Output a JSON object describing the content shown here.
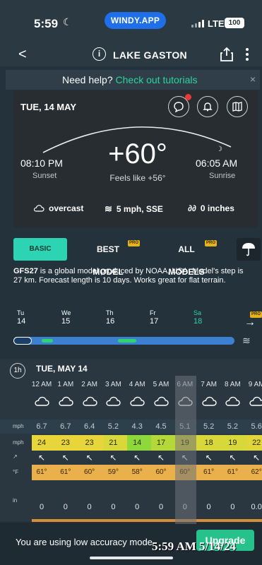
{
  "status_bar": {
    "time": "5:59",
    "app_pill": "WINDY.APP",
    "network": "LTE",
    "battery": "100"
  },
  "header": {
    "title": "LAKE GASTON",
    "info": "i"
  },
  "help_banner": {
    "text": "Need help?",
    "link": "Check out tutorials",
    "close": "×"
  },
  "summary": {
    "date": "TUE, 14 MAY",
    "temperature": "+60°",
    "feels_like": "Feels like +56°",
    "sunset_time": "08:10 PM",
    "sunset_label": "Sunset",
    "sunrise_time": "06:05 AM",
    "sunrise_label": "Sunrise",
    "cloud": "overcast",
    "wind": "5 mph, SSE",
    "precip": "0 inches"
  },
  "model_tabs": {
    "basic": "BASIC",
    "best": "BEST MODEL",
    "all": "ALL MODELS",
    "pro_badge": "PRO"
  },
  "description": {
    "model": "GFS27",
    "text": " is a global model produced by NOAA, USA. Model's step is 27 km. Forecast length is 10 days. Works great for flat terrain."
  },
  "days": [
    {
      "dow": "Tu",
      "num": "14"
    },
    {
      "dow": "We",
      "num": "15"
    },
    {
      "dow": "Th",
      "num": "16"
    },
    {
      "dow": "Fr",
      "num": "17"
    },
    {
      "dow": "Sa",
      "num": "18"
    }
  ],
  "table": {
    "interval": "1h",
    "date": "TUE, MAY 14",
    "hours": [
      "12 AM",
      "1 AM",
      "2 AM",
      "3 AM",
      "4 AM",
      "5 AM",
      "6 AM",
      "7 AM",
      "8 AM",
      "9 AM"
    ],
    "labels": {
      "wind": "mph",
      "gust": "mph",
      "temp": "°F",
      "precip": "in"
    },
    "wind": [
      "6.7",
      "6.7",
      "6.4",
      "5.2",
      "4.3",
      "4.5",
      "5.1",
      "5.2",
      "5.2",
      "5.6"
    ],
    "gust": [
      "24",
      "23",
      "23",
      "21",
      "14",
      "17",
      "19",
      "18",
      "19",
      "22"
    ],
    "temp": [
      "61°",
      "61°",
      "60°",
      "59°",
      "58°",
      "60°",
      "60°",
      "61°",
      "61°",
      "62°"
    ],
    "precip": [
      "0",
      "0",
      "0",
      "0",
      "0",
      "0",
      "0",
      "0",
      "0",
      "0.0"
    ],
    "gust_colors": [
      "#e8d53a",
      "#e8d53a",
      "#e8d53a",
      "#d8d83a",
      "#8fd83a",
      "#b4d83a",
      "#d8d83a",
      "#d8d83a",
      "#d8d83a",
      "#e0d53a"
    ]
  },
  "footer": {
    "message": "You are using low accuracy mode",
    "upgrade": "Upgrade",
    "stamp": "5:59 AM 5/14/24"
  }
}
